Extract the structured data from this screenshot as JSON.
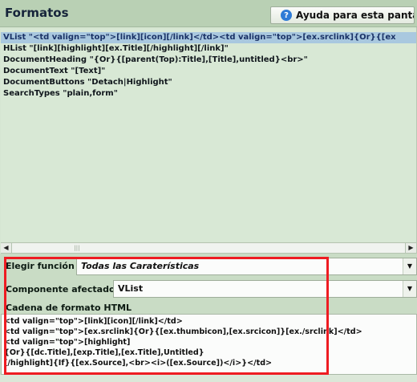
{
  "window": {
    "title": "Formatos"
  },
  "help_button": {
    "label": "Ayuda para esta pantalla",
    "icon": "help-icon"
  },
  "format_list": [
    {
      "text": "VList \"<td valign=\"top\">[link][icon][/link]</td><td valign=\"top\">[ex.srclink]{Or}{[ex",
      "selected": true
    },
    {
      "text": "HList \"[link][highlight][ex.Title][/highlight][/link]\"",
      "selected": false
    },
    {
      "text": "DocumentHeading \"{Or}{[parent(Top):Title],[Title],untitled}<br>\"",
      "selected": false
    },
    {
      "text": "DocumentText \"[Text]\"",
      "selected": false
    },
    {
      "text": "DocumentButtons \"Detach|Highlight\"",
      "selected": false
    },
    {
      "text": "SearchTypes \"plain,form\"",
      "selected": false
    }
  ],
  "function_select": {
    "label": "Elegir función",
    "value": "Todas las Caraterísticas"
  },
  "component_select": {
    "label": "Componente afectado",
    "value": "VList"
  },
  "format_string": {
    "label": "Cadena de formato HTML",
    "lines": [
      "<td valign=\"top\">[link][icon][/link]</td>",
      "<td valign=\"top\">[ex.srclink]{Or}{[ex.thumbicon],[ex.srcicon]}[ex./srclink]</td>",
      "<td valign=\"top\">[highlight]",
      "{Or}{[dc.Title],[exp.Title],[ex.Title],Untitled}",
      "[/highlight]{If}{[ex.Source],<br><i>([ex.Source])</i>}</td>"
    ]
  },
  "colors": {
    "highlight_box": "#ee1c22",
    "selection": "#a9c8df",
    "header": "#b9d0b4"
  }
}
